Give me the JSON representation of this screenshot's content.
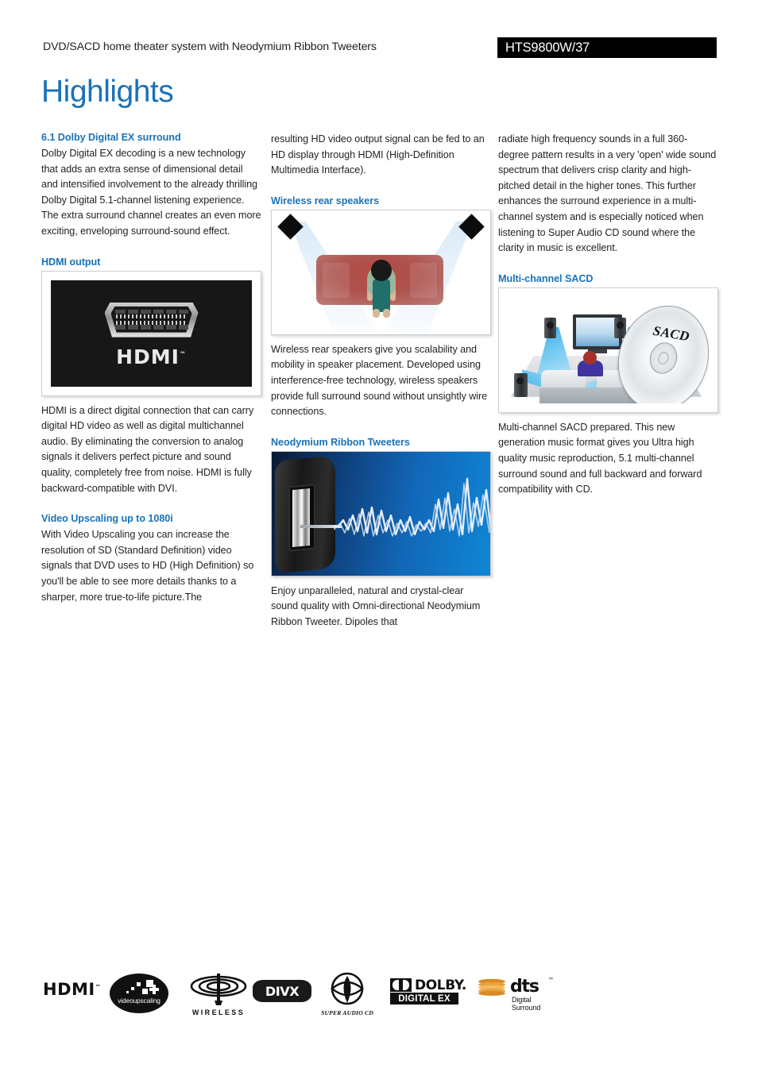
{
  "header": {
    "subtitle": "DVD/SACD home theater system with Neodymium Ribbon Tweeters",
    "model": "HTS9800W/37"
  },
  "page_title": "Highlights",
  "colors": {
    "accent_blue": "#1a72b8",
    "body_text": "#231f20",
    "model_box_bg": "#000000",
    "dts_orange": "#e8a33d"
  },
  "columns": [
    {
      "id": "column-1",
      "blocks": [
        {
          "type": "section",
          "heading": "6.1 Dolby Digital EX surround",
          "body": "Dolby Digital EX decoding is a new technology that adds an extra sense of dimensional detail and intensified involvement to the already thrilling Dolby Digital 5.1-channel listening experience. The extra surround channel creates an even more exciting, enveloping surround-sound effect."
        },
        {
          "type": "section-with-image",
          "heading": "HDMI output",
          "image_name": "hdmi-port-photo",
          "image_caption_alt": "HDMI",
          "body": "HDMI is a direct digital connection that can carry digital HD video as well as digital multichannel audio. By eliminating the conversion to analog signals it delivers perfect picture and sound quality, completely free from noise. HDMI is fully backward-compatible with DVI."
        },
        {
          "type": "section",
          "heading": "Video Upscaling up to 1080i",
          "body": "With Video Upscaling you can increase the resolution of SD (Standard Definition) video signals that DVD uses to HD (High Definition) so you'll be able to see more details thanks to a sharper, more true-to-life picture.The"
        }
      ]
    },
    {
      "id": "column-2",
      "blocks": [
        {
          "type": "continuation",
          "body": "resulting HD video output signal can be fed to an HD display through HDMI (High-Definition Multimedia Interface)."
        },
        {
          "type": "section-with-image",
          "heading": "Wireless rear speakers",
          "image_name": "wireless-rear-speakers-diagram",
          "body": "Wireless rear speakers give you scalability and mobility in speaker placement. Developed using interference-free technology, wireless speakers provide full surround sound without unsightly wire connections."
        },
        {
          "type": "section-with-image",
          "heading": "Neodymium Ribbon Tweeters",
          "image_name": "ribbon-tweeter-waveform-illustration",
          "body": "Enjoy unparalleled, natural and crystal-clear sound quality with Omni-directional Neodymium Ribbon Tweeter. Dipoles that"
        }
      ]
    },
    {
      "id": "column-3",
      "blocks": [
        {
          "type": "continuation",
          "body": "radiate high frequency sounds in a full 360-degree pattern results in a very 'open' wide sound spectrum that delivers crisp clarity and high-pitched detail in the higher tones. This further enhances the surround experience in a multi-channel system and is especially noticed when listening to Super Audio CD sound where the clarity in music is excellent."
        },
        {
          "type": "section-with-image",
          "heading": "Multi-channel SACD",
          "image_name": "sacd-home-theater-illustration",
          "image_label": "SACD",
          "body": "Multi-channel SACD prepared. This new generation music format gives you Ultra high quality music reproduction, 5.1 multi-channel surround sound and full backward and forward compatibility with CD."
        }
      ]
    }
  ],
  "footer_logos": [
    {
      "id": "hdmi",
      "text": "HDMI",
      "tm": "™"
    },
    {
      "id": "videoupscaling",
      "text": "videoupscaling"
    },
    {
      "id": "wireless",
      "text": "WIRELESS"
    },
    {
      "id": "divx",
      "text": "DIVX"
    },
    {
      "id": "super-audio-cd",
      "text": "SUPER AUDIO CD"
    },
    {
      "id": "dolby-digital-ex",
      "text": "DOLBY.",
      "subtext": "DIGITAL EX"
    },
    {
      "id": "dts-digital-surround",
      "text": "dts",
      "subtext": "Digital Surround",
      "tm": "™"
    }
  ]
}
